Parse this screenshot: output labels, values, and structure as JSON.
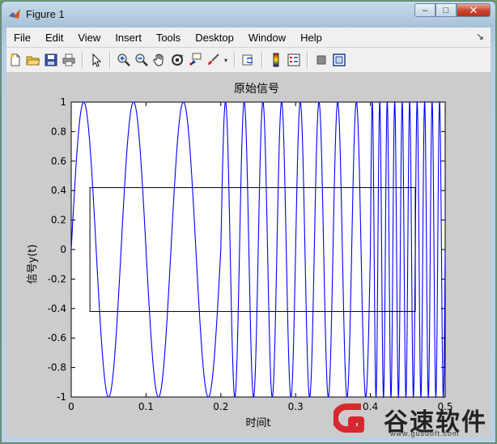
{
  "window": {
    "title": "Figure 1",
    "controls": {
      "minimize": "–",
      "maximize": "□",
      "close": "✕"
    }
  },
  "menu": {
    "items": [
      "File",
      "Edit",
      "View",
      "Insert",
      "Tools",
      "Desktop",
      "Window",
      "Help"
    ],
    "overflow": "↘"
  },
  "toolbar": {
    "buttons": [
      {
        "name": "new-figure-icon"
      },
      {
        "name": "open-file-icon"
      },
      {
        "name": "save-icon"
      },
      {
        "name": "print-icon"
      },
      {
        "name": "edit-plot-arrow-icon"
      },
      {
        "name": "zoom-in-icon"
      },
      {
        "name": "zoom-out-icon"
      },
      {
        "name": "pan-hand-icon"
      },
      {
        "name": "rotate-3d-icon"
      },
      {
        "name": "data-cursor-icon"
      },
      {
        "name": "brush-icon"
      },
      {
        "name": "link-icon"
      },
      {
        "name": "insert-colorbar-icon"
      },
      {
        "name": "insert-legend-icon"
      },
      {
        "name": "hide-plot-tools-icon"
      },
      {
        "name": "show-plot-tools-icon"
      }
    ]
  },
  "chart_data": {
    "type": "line",
    "title": "原始信号",
    "xlabel": "时间t",
    "ylabel": "信号y(t)",
    "xlim": [
      0,
      0.5
    ],
    "ylim": [
      -1,
      1
    ],
    "xticks": [
      "0",
      "0.1",
      "0.2",
      "0.3",
      "0.4",
      "0.5"
    ],
    "yticks": [
      "-1",
      "-0.8",
      "-0.6",
      "-0.4",
      "-0.2",
      "0",
      "0.2",
      "0.4",
      "0.6",
      "0.8",
      "1"
    ],
    "series": [
      {
        "color": "#0000ff",
        "segments": [
          {
            "t_start": 0,
            "t_end": 0.2,
            "freq_hz": 15
          },
          {
            "t_start": 0.2,
            "t_end": 0.4,
            "freq_hz": 40
          },
          {
            "t_start": 0.4,
            "t_end": 0.5,
            "freq_hz": 100
          }
        ]
      }
    ],
    "annotation_rectangle": {
      "x": [
        0.025,
        0.46
      ],
      "y": [
        -0.42,
        0.42
      ],
      "color": "#000000"
    },
    "grid": false
  },
  "watermark": {
    "text": "谷速软件",
    "url": "www.gusuoft.com",
    "brand_color": "#d7282f"
  }
}
